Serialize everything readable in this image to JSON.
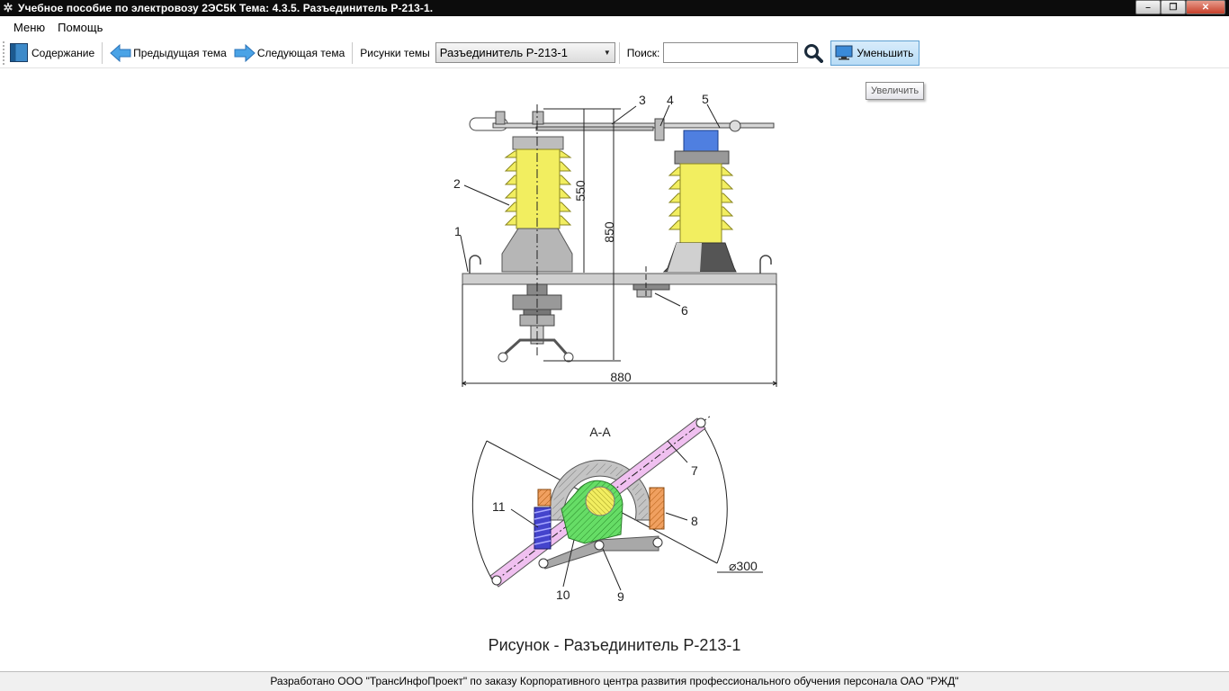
{
  "window": {
    "title": "Учебное пособие по электровозу 2ЭС5К Тема: 4.3.5. Разъединитель Р-213-1.",
    "icon": "gear-icon"
  },
  "menu": {
    "items": [
      "Меню",
      "Помощь"
    ]
  },
  "toolbar": {
    "contents_label": "Содержание",
    "prev_label": "Предыдущая тема",
    "next_label": "Следующая тема",
    "figures_label": "Рисунки темы",
    "figure_selected": "Разъединитель Р-213-1",
    "search_label": "Поиск:",
    "search_value": "",
    "shrink_label": "Уменьшить"
  },
  "tooltip": "Увеличить",
  "figure": {
    "caption": "Рисунок - Разъединитель Р-213-1",
    "section_label": "А-А",
    "callouts": [
      "1",
      "2",
      "3",
      "4",
      "5",
      "6",
      "7",
      "8",
      "9",
      "10",
      "11"
    ],
    "dimensions": {
      "height_upper": "550",
      "height_total": "850",
      "width": "880",
      "diameter": "⌀300"
    }
  },
  "footer": "Разработано ООО \"ТрансИнфоПроект\" по заказу Корпоративного центра развития профессионального обучения персонала ОАО \"РЖД\"",
  "colors": {
    "insulator": "#f2ee60",
    "contact_blue": "#4f7fe0",
    "hatch_green": "#66dd66",
    "spring_blue": "#4444cc",
    "rod_pink": "#f0c0f0",
    "bolt_orange": "#f0a060"
  }
}
